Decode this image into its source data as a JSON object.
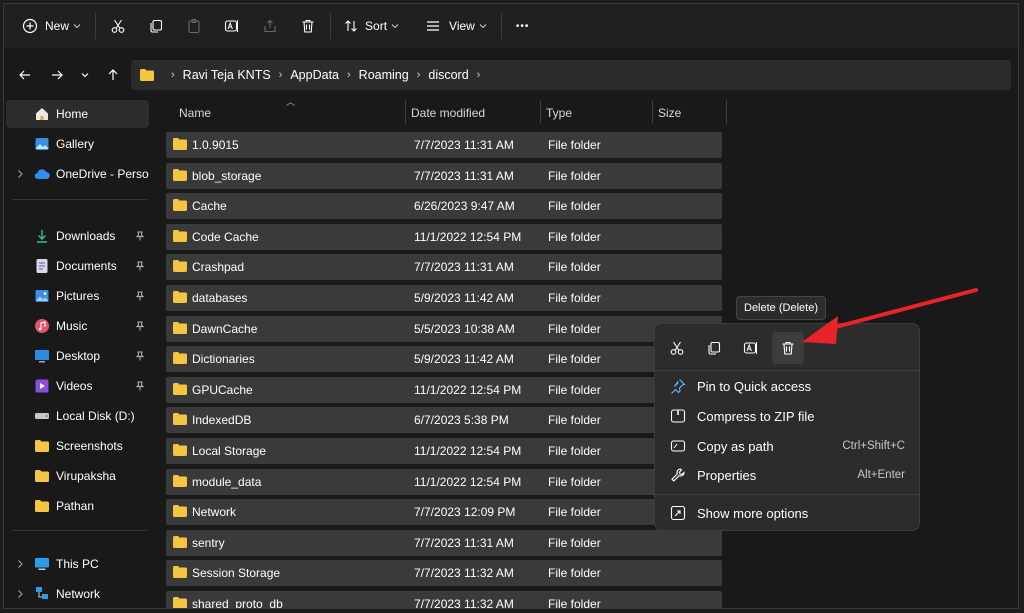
{
  "toolbar": {
    "new_label": "New",
    "sort_label": "Sort",
    "view_label": "View",
    "more_label": "•••"
  },
  "breadcrumbs": [
    "Ravi Teja KNTS",
    "AppData",
    "Roaming",
    "discord"
  ],
  "sidebar": {
    "items": [
      {
        "label": "Home",
        "icon": "home-icon"
      },
      {
        "label": "Gallery",
        "icon": "gallery-icon"
      },
      {
        "label": "OneDrive - Persona",
        "icon": "cloud-icon"
      },
      {
        "label": "Downloads",
        "icon": "download-icon"
      },
      {
        "label": "Documents",
        "icon": "documents-icon"
      },
      {
        "label": "Pictures",
        "icon": "pictures-icon"
      },
      {
        "label": "Music",
        "icon": "music-icon"
      },
      {
        "label": "Desktop",
        "icon": "desktop-icon"
      },
      {
        "label": "Videos",
        "icon": "videos-icon"
      },
      {
        "label": "Local Disk (D:)",
        "icon": "drive-icon"
      },
      {
        "label": "Screenshots",
        "icon": "folder-icon"
      },
      {
        "label": "Virupaksha",
        "icon": "folder-icon"
      },
      {
        "label": "Pathan",
        "icon": "folder-icon"
      },
      {
        "label": "This PC",
        "icon": "pc-icon"
      },
      {
        "label": "Network",
        "icon": "network-icon"
      }
    ]
  },
  "columns": {
    "name": "Name",
    "date": "Date modified",
    "type": "Type",
    "size": "Size"
  },
  "files": [
    {
      "name": "1.0.9015",
      "date": "7/7/2023 11:31 AM",
      "type": "File folder"
    },
    {
      "name": "blob_storage",
      "date": "7/7/2023 11:31 AM",
      "type": "File folder"
    },
    {
      "name": "Cache",
      "date": "6/26/2023 9:47 AM",
      "type": "File folder"
    },
    {
      "name": "Code Cache",
      "date": "11/1/2022 12:54 PM",
      "type": "File folder"
    },
    {
      "name": "Crashpad",
      "date": "7/7/2023 11:31 AM",
      "type": "File folder"
    },
    {
      "name": "databases",
      "date": "5/9/2023 11:42 AM",
      "type": "File folder"
    },
    {
      "name": "DawnCache",
      "date": "5/5/2023 10:38 AM",
      "type": "File folder"
    },
    {
      "name": "Dictionaries",
      "date": "5/9/2023 11:42 AM",
      "type": "File folder"
    },
    {
      "name": "GPUCache",
      "date": "11/1/2022 12:54 PM",
      "type": "File folder"
    },
    {
      "name": "IndexedDB",
      "date": "6/7/2023 5:38 PM",
      "type": "File folder"
    },
    {
      "name": "Local Storage",
      "date": "11/1/2022 12:54 PM",
      "type": "File folder"
    },
    {
      "name": "module_data",
      "date": "11/1/2022 12:54 PM",
      "type": "File folder"
    },
    {
      "name": "Network",
      "date": "7/7/2023 12:09 PM",
      "type": "File folder"
    },
    {
      "name": "sentry",
      "date": "7/7/2023 11:31 AM",
      "type": "File folder"
    },
    {
      "name": "Session Storage",
      "date": "7/7/2023 11:32 AM",
      "type": "File folder"
    },
    {
      "name": "shared_proto_db",
      "date": "7/7/2023 11:32 AM",
      "type": "File folder"
    }
  ],
  "tooltip": "Delete (Delete)",
  "context_menu": {
    "items": [
      {
        "label": "Pin to Quick access",
        "shortcut": "",
        "icon": "pin-icon"
      },
      {
        "label": "Compress to ZIP file",
        "shortcut": "",
        "icon": "zip-icon"
      },
      {
        "label": "Copy as path",
        "shortcut": "Ctrl+Shift+C",
        "icon": "copy-path-icon"
      },
      {
        "label": "Properties",
        "shortcut": "Alt+Enter",
        "icon": "properties-icon"
      }
    ],
    "more": {
      "label": "Show more options",
      "icon": "more-options-icon"
    }
  },
  "colors": {
    "folder": "#f4c542",
    "accent_arrow": "#e8242a",
    "row_bg": "#3a3a3a"
  }
}
